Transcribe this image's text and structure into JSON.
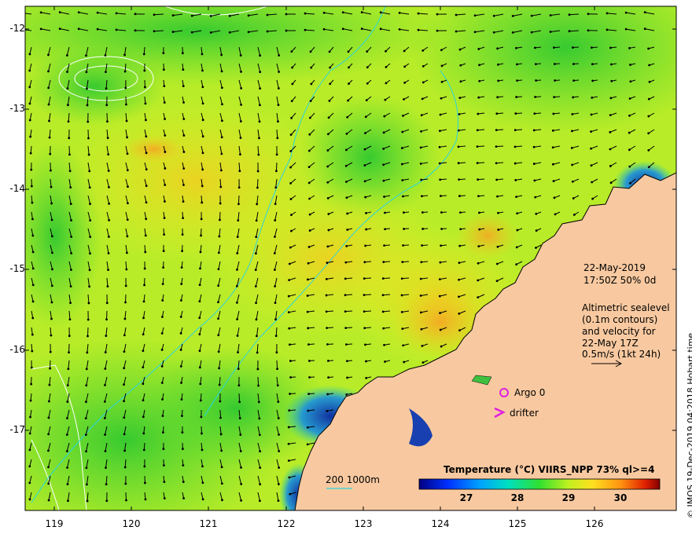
{
  "map": {
    "x_ticks": [
      "119",
      "120",
      "121",
      "122",
      "123",
      "124",
      "125",
      "126"
    ],
    "y_ticks": [
      "-12",
      "-13",
      "-14",
      "-15",
      "-16",
      "-17"
    ]
  },
  "info": {
    "date": "22-May-2019",
    "time_line": "17:50Z  50% 0d",
    "altimetry_lines": [
      "Altimetric sealevel",
      "(0.1m contours)",
      "and velocity for",
      "22-May 17Z",
      "0.5m/s (1kt 24h)"
    ]
  },
  "legend": {
    "argo": "Argo 0",
    "drifter": "drifter",
    "bathy": "200  1000m"
  },
  "colorbar": {
    "title": "Temperature (°C) VIIRS_NPP 73% ql>=4",
    "ticks": [
      "27",
      "28",
      "29",
      "30"
    ]
  },
  "credit": "© IMOS 19-Dec-2019 04:2018 Hobart time",
  "colors": {
    "land": "#f8c9a0",
    "sst_green": "#3ed63a",
    "sst_yellow": "#e8f026",
    "sst_orange": "#f5a623",
    "cold_blue": "#1a3aa0",
    "argo_magenta": "#e020e0",
    "bathy_cyan": "#2ad4e0"
  }
}
